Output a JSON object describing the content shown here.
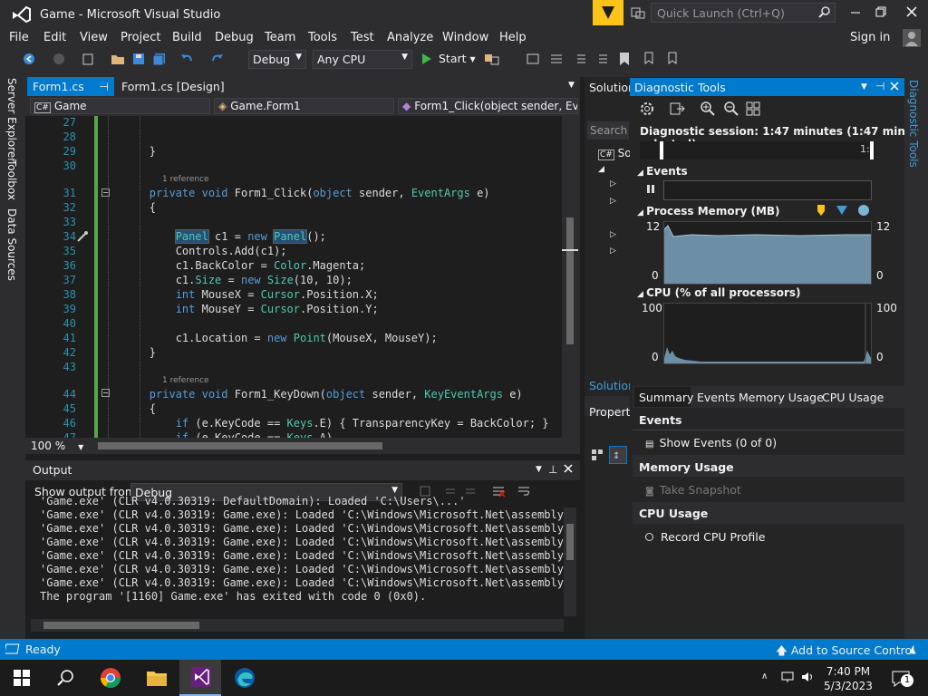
{
  "window": {
    "title": "Game - Microsoft Visual Studio",
    "quick_launch": "Quick Launch (Ctrl+Q)",
    "sign_in": "Sign in"
  },
  "menu": [
    "File",
    "Edit",
    "View",
    "Project",
    "Build",
    "Debug",
    "Team",
    "Tools",
    "Test",
    "Analyze",
    "Window",
    "Help"
  ],
  "toolbar": {
    "config": "Debug",
    "platform": "Any CPU",
    "start": "Start"
  },
  "left_tabs": [
    "Server Explorer",
    "Toolbox",
    "Data Sources"
  ],
  "doc_tabs": [
    "Form1.cs",
    "Form1.cs [Design]"
  ],
  "nav": {
    "project": "Game",
    "class": "Game.Form1",
    "member": "Form1_Click(object sender, Eve"
  },
  "zoom": "100 %",
  "code_lines": [
    {
      "n": "27",
      "t": ""
    },
    {
      "n": "28",
      "t": ""
    },
    {
      "n": "29",
      "t": "        }"
    },
    {
      "n": "30",
      "t": ""
    },
    {
      "n": "31",
      "t": "        private void Form1_Click(object sender, EventArgs e)"
    },
    {
      "n": "32",
      "t": "        {"
    },
    {
      "n": "33",
      "t": ""
    },
    {
      "n": "34",
      "t": "            Panel c1 = new Panel();"
    },
    {
      "n": "35",
      "t": "            Controls.Add(c1);"
    },
    {
      "n": "36",
      "t": "            c1.BackColor = Color.Magenta;"
    },
    {
      "n": "37",
      "t": "            c1.Size = new Size(10, 10);"
    },
    {
      "n": "38",
      "t": "            int MouseX = Cursor.Position.X;"
    },
    {
      "n": "39",
      "t": "            int MouseY = Cursor.Position.Y;"
    },
    {
      "n": "40",
      "t": ""
    },
    {
      "n": "41",
      "t": "            c1.Location = new Point(MouseX, MouseY);"
    },
    {
      "n": "42",
      "t": "        }"
    },
    {
      "n": "43",
      "t": ""
    },
    {
      "n": "44",
      "t": "        private void Form1_KeyDown(object sender, KeyEventArgs e)"
    },
    {
      "n": "45",
      "t": "        {"
    },
    {
      "n": "46",
      "t": "            if (e.KeyCode == Keys.E) { TransparencyKey = BackColor; }"
    },
    {
      "n": "47",
      "t": "            if (e.KeyCode == Keys.A)"
    }
  ],
  "reference_label": "1 reference",
  "output": {
    "title": "Output",
    "show_from_label": "Show output from:",
    "source": "Debug",
    "lines": [
      "'Game.exe' (CLR v4.0.30319: DefaultDomain): Loaded 'C:\\Users\\...'",
      "'Game.exe' (CLR v4.0.30319: Game.exe): Loaded 'C:\\Windows\\Microsoft.Net\\assembly\\GA",
      "'Game.exe' (CLR v4.0.30319: Game.exe): Loaded 'C:\\Windows\\Microsoft.Net\\assembly\\GA",
      "'Game.exe' (CLR v4.0.30319: Game.exe): Loaded 'C:\\Windows\\Microsoft.Net\\assembly\\GA",
      "'Game.exe' (CLR v4.0.30319: Game.exe): Loaded 'C:\\Windows\\Microsoft.Net\\assembly\\GA",
      "'Game.exe' (CLR v4.0.30319: Game.exe): Loaded 'C:\\Windows\\Microsoft.Net\\assembly\\GA",
      "'Game.exe' (CLR v4.0.30319: Game.exe): Loaded 'C:\\Windows\\Microsoft.Net\\assembly\\GA",
      "The program '[1160] Game.exe' has exited with code 0 (0x0)."
    ]
  },
  "solution": {
    "tab": "Solution",
    "search": "Search S",
    "item": "So",
    "bottom_tab": "Solution",
    "properties": "Properti"
  },
  "diagnostics": {
    "title": "Diagnostic Tools",
    "session": "Diagnostic session: 1:47 minutes (1:47 min selected)",
    "timeline_label": "1:",
    "events_header": "Events",
    "memory_header": "Process Memory (MB)",
    "memory_max": "12",
    "memory_min": "0",
    "cpu_header": "CPU (% of all processors)",
    "cpu_max": "100",
    "cpu_min": "0",
    "tabs": [
      "Summary",
      "Events",
      "Memory Usage",
      "CPU Usage"
    ],
    "sec_events": "Events",
    "show_events": "Show Events (0 of 0)",
    "sec_memory": "Memory Usage",
    "take_snapshot": "Take Snapshot",
    "sec_cpu": "CPU Usage",
    "record_cpu": "Record CPU Profile"
  },
  "right_strip": "Diagnostic Tools",
  "status": {
    "ready": "Ready",
    "source_control": "Add to Source Control"
  },
  "taskbar": {
    "time": "7:40 PM",
    "date": "5/3/2023",
    "notifications": "1"
  },
  "colors": {
    "accent": "#007acc",
    "vs_purple": "#68217a",
    "chart_fill": "#6d8fa6"
  }
}
